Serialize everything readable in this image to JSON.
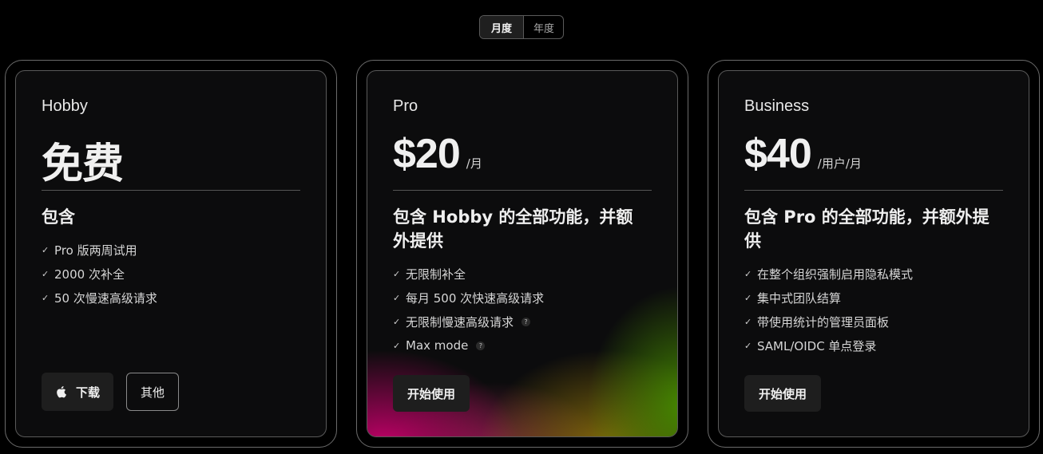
{
  "billing_toggle": {
    "monthly_label": "月度",
    "yearly_label": "年度",
    "selected": "monthly"
  },
  "plans": [
    {
      "name": "Hobby",
      "price": "免费",
      "price_unit": "",
      "includes_heading": "包含",
      "features": [
        {
          "text": "Pro 版两周试用",
          "help": false
        },
        {
          "text": "2000 次补全",
          "help": false
        },
        {
          "text": "50 次慢速高级请求",
          "help": false
        }
      ],
      "buttons": {
        "download_label": "下载",
        "download_icon": "apple-icon",
        "other_label": "其他"
      }
    },
    {
      "name": "Pro",
      "price": "$20",
      "price_unit": "/月",
      "includes_heading_line1": "包含 Hobby 的全部功能，并额",
      "includes_heading_line2": "外提供",
      "features": [
        {
          "text": "无限制补全",
          "help": false
        },
        {
          "text": "每月 500 次快速高级请求",
          "help": false
        },
        {
          "text": "无限制慢速高级请求",
          "help": true
        },
        {
          "text": "Max mode",
          "help": true
        }
      ],
      "buttons": {
        "start_label": "开始使用"
      }
    },
    {
      "name": "Business",
      "price": "$40",
      "price_unit": "/用户/月",
      "includes_heading_line1": "包含 Pro 的全部功能，并额外提",
      "includes_heading_line2": "供",
      "features": [
        {
          "text": "在整个组织强制启用隐私模式",
          "help": false
        },
        {
          "text": "集中式团队结算",
          "help": false
        },
        {
          "text": "带使用统计的管理员面板",
          "help": false
        },
        {
          "text": "SAML/OIDC 单点登录",
          "help": false
        }
      ],
      "buttons": {
        "start_label": "开始使用"
      }
    }
  ],
  "colors": {
    "background": "#000000",
    "card": "#0c0c0d",
    "button": "#1e1e1e",
    "glow_green": "#468c00",
    "glow_magenta": "#cd006e"
  }
}
